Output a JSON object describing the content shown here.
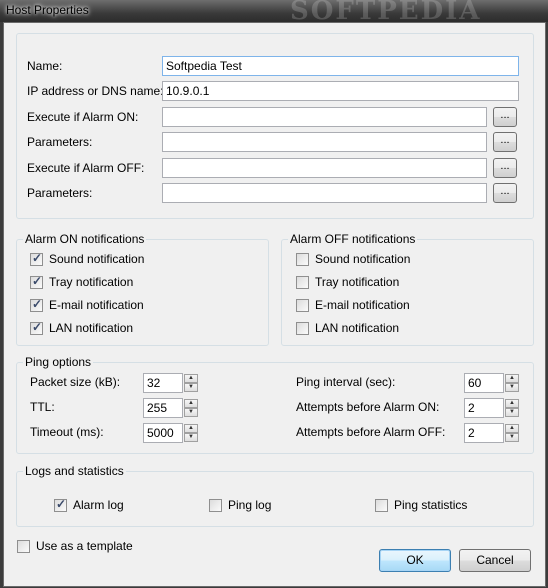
{
  "window": {
    "title": "Host Properties",
    "watermark": "SOFTPEDIA"
  },
  "fields": {
    "name_label": "Name:",
    "name_value": "Softpedia Test",
    "ip_label": "IP address or DNS name:",
    "ip_value": "10.9.0.1",
    "exec_on_label": "Execute if Alarm ON:",
    "params_on_label": "Parameters:",
    "exec_off_label": "Execute if Alarm OFF:",
    "params_off_label": "Parameters:",
    "browse_label": "..."
  },
  "alarm_on": {
    "title": "Alarm ON notifications",
    "items": [
      {
        "label": "Sound notification",
        "checked": true
      },
      {
        "label": "Tray notification",
        "checked": true
      },
      {
        "label": "E-mail notification",
        "checked": true
      },
      {
        "label": "LAN notification",
        "checked": true
      }
    ]
  },
  "alarm_off": {
    "title": "Alarm OFF notifications",
    "items": [
      {
        "label": "Sound notification",
        "checked": false
      },
      {
        "label": "Tray notification",
        "checked": false
      },
      {
        "label": "E-mail notification",
        "checked": false
      },
      {
        "label": "LAN notification",
        "checked": false
      }
    ]
  },
  "ping": {
    "title": "Ping options",
    "packet_size_label": "Packet size  (kB):",
    "packet_size": "32",
    "ttl_label": "TTL:",
    "ttl": "255",
    "timeout_label": "Timeout (ms):",
    "timeout": "5000",
    "interval_label": "Ping interval (sec):",
    "interval": "60",
    "attempts_on_label": "Attempts before Alarm ON:",
    "attempts_on": "2",
    "attempts_off_label": "Attempts before Alarm OFF:",
    "attempts_off": "2",
    "up_glyph": "▲",
    "down_glyph": "▼"
  },
  "logs": {
    "title": "Logs and statistics",
    "alarm_log": {
      "label": "Alarm log",
      "checked": true
    },
    "ping_log": {
      "label": "Ping log",
      "checked": false
    },
    "ping_stats": {
      "label": "Ping statistics",
      "checked": false
    }
  },
  "template": {
    "label": "Use as a template",
    "checked": false
  },
  "buttons": {
    "ok": "OK",
    "cancel": "Cancel"
  },
  "check_glyph": "✓"
}
